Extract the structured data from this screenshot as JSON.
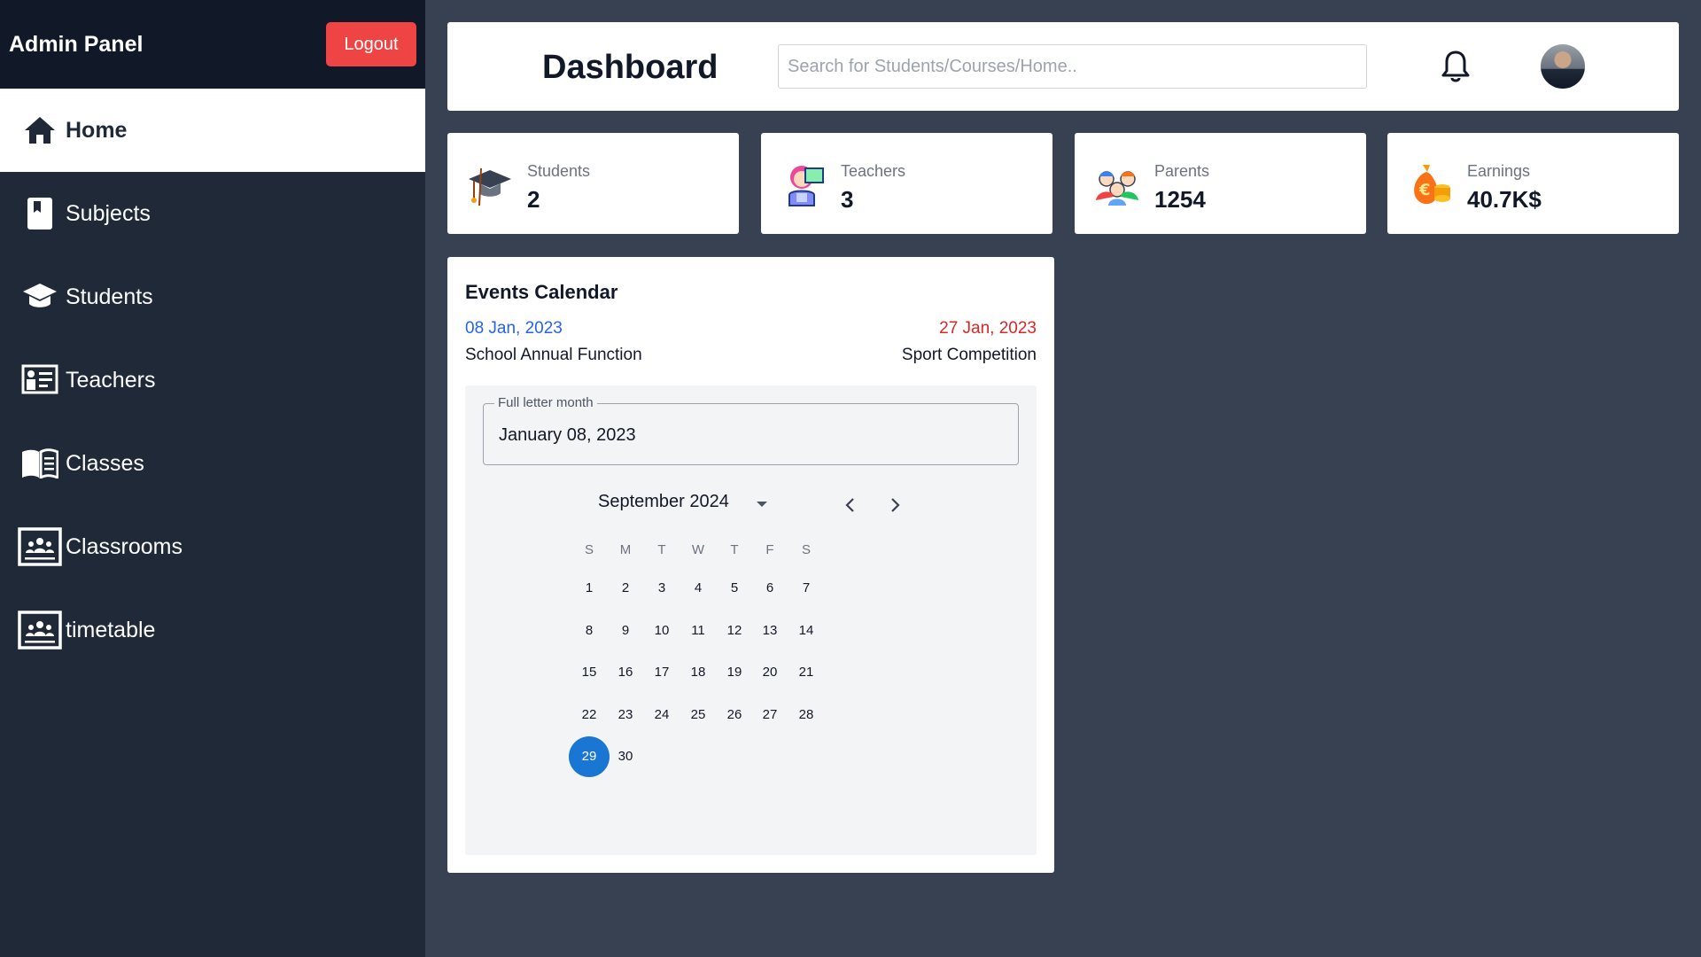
{
  "sidebar": {
    "title": "Admin Panel",
    "logout_label": "Logout",
    "items": [
      {
        "label": "Home",
        "icon": "home-icon"
      },
      {
        "label": "Subjects",
        "icon": "book-icon"
      },
      {
        "label": "Students",
        "icon": "graduation-cap-icon"
      },
      {
        "label": "Teachers",
        "icon": "teacher-board-icon"
      },
      {
        "label": "Classes",
        "icon": "open-book-icon"
      },
      {
        "label": "Classrooms",
        "icon": "classroom-icon"
      },
      {
        "label": "timetable",
        "icon": "classroom-icon"
      }
    ]
  },
  "header": {
    "title": "Dashboard",
    "search_placeholder": "Search for Students/Courses/Home..",
    "notification_icon": "bell-icon",
    "avatar_icon": "user-avatar"
  },
  "stats": [
    {
      "label": "Students",
      "value": "2",
      "icon": "graduation-cap-icon"
    },
    {
      "label": "Teachers",
      "value": "3",
      "icon": "teacher-icon"
    },
    {
      "label": "Parents",
      "value": "1254",
      "icon": "parents-icon"
    },
    {
      "label": "Earnings",
      "value": "40.7K$",
      "icon": "money-bag-icon"
    }
  ],
  "events": {
    "title": "Events Calendar",
    "left": {
      "date": "08 Jan, 2023",
      "name": "School Annual Function"
    },
    "right": {
      "date": "27 Jan, 2023",
      "name": "Sport Competition"
    }
  },
  "calendar": {
    "field_label": "Full letter month",
    "field_value": "January 08, 2023",
    "month_label": "September 2024",
    "weekdays": [
      "S",
      "M",
      "T",
      "W",
      "T",
      "F",
      "S"
    ],
    "days": [
      "1",
      "2",
      "3",
      "4",
      "5",
      "6",
      "7",
      "8",
      "9",
      "10",
      "11",
      "12",
      "13",
      "14",
      "15",
      "16",
      "17",
      "18",
      "19",
      "20",
      "21",
      "22",
      "23",
      "24",
      "25",
      "26",
      "27",
      "28",
      "29",
      "30"
    ],
    "selected_day": "29",
    "accent_color": "#1976d2"
  },
  "colors": {
    "sidebar_bg": "#1f2937",
    "sidebar_header_bg": "#111827",
    "content_bg": "#374151",
    "logout_bg": "#ef4444",
    "event_left_date": "#2563eb",
    "event_right_date": "#dc2626"
  }
}
